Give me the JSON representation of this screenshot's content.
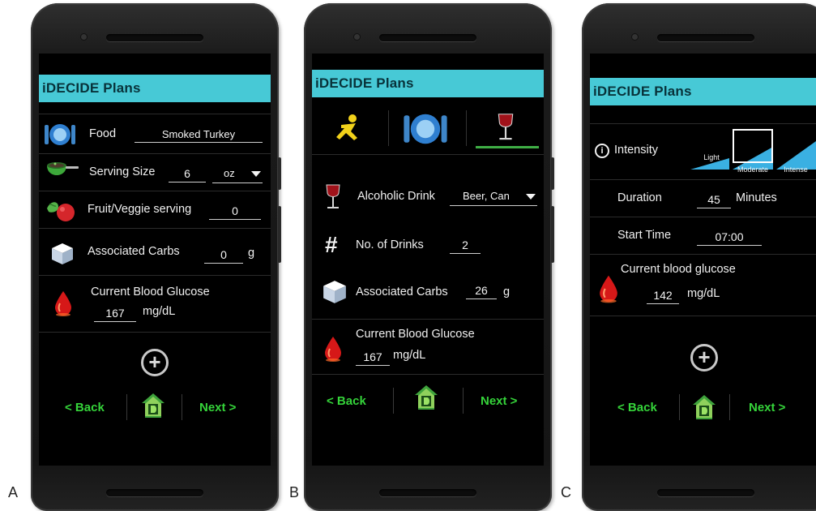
{
  "labels": {
    "a": "A",
    "b": "B",
    "c": "C"
  },
  "app_title": "iDECIDE Plans",
  "colors": {
    "title_bar": "#47c9d6",
    "nav_green": "#35d43a",
    "tab_underline": "#3fae45"
  },
  "nav": {
    "back": "< Back",
    "next": "Next >"
  },
  "food_screen": {
    "food_label": "Food",
    "food_value": "Smoked Turkey",
    "serving_label": "Serving Size",
    "serving_value": "6",
    "serving_unit": "oz",
    "fruit_label": "Fruit/Veggie serving",
    "fruit_value": "0",
    "carbs_label": "Associated Carbs",
    "carbs_value": "0",
    "carbs_unit": "g",
    "glucose_label": "Current Blood Glucose",
    "glucose_value": "167",
    "glucose_unit": "mg/dL",
    "add": "+"
  },
  "drink_screen": {
    "tabs": [
      "exercise-icon",
      "meal-icon",
      "wine-glass-icon"
    ],
    "drink_label": "Alcoholic Drink",
    "drink_value": "Beer, Can",
    "count_symbol": "#",
    "count_label": "No. of Drinks",
    "count_value": "2",
    "carbs_label": "Associated Carbs",
    "carbs_value": "26",
    "carbs_unit": "g",
    "glucose_label": "Current Blood Glucose",
    "glucose_value": "167",
    "glucose_unit": "mg/dL"
  },
  "exercise_screen": {
    "info_symbol": "i",
    "intensity_label": "Intensity",
    "intensity_levels": [
      "Light",
      "Moderate",
      "Intense"
    ],
    "intensity_selected": "Moderate",
    "duration_label": "Duration",
    "duration_value": "45",
    "duration_unit": "Minutes",
    "start_label": "Start Time",
    "start_value": "07:00",
    "glucose_label": "Current blood glucose",
    "glucose_value": "142",
    "glucose_unit": "mg/dL",
    "add": "+"
  }
}
